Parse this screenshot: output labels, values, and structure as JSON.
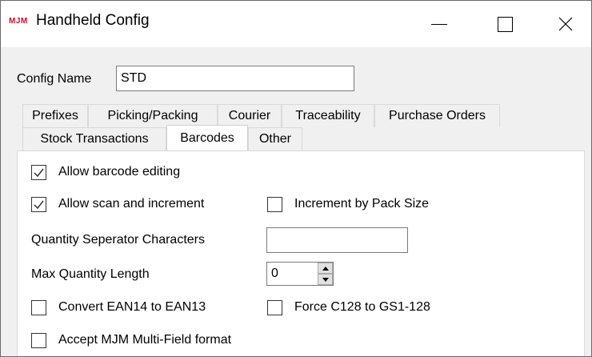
{
  "window": {
    "logo_text": "MJM",
    "title": "Handheld Config"
  },
  "config": {
    "name_label": "Config Name",
    "name_value": "STD"
  },
  "tabs": {
    "row1": [
      "Prefixes",
      "Picking/Packing",
      "Courier",
      "Traceability",
      "Purchase Orders"
    ],
    "row2": [
      "Stock Transactions",
      "Barcodes",
      "Other"
    ],
    "active": "Barcodes"
  },
  "barcodes": {
    "allow_editing": {
      "label": "Allow barcode editing",
      "checked": true
    },
    "allow_scan_increment": {
      "label": "Allow scan and increment",
      "checked": true
    },
    "increment_pack_size": {
      "label": "Increment by Pack Size",
      "checked": false
    },
    "qty_separator": {
      "label": "Quantity Seperator Characters",
      "value": ""
    },
    "max_qty_length": {
      "label": "Max Quantity Length",
      "value": "0"
    },
    "convert_ean": {
      "label": "Convert EAN14 to EAN13",
      "checked": false
    },
    "force_c128": {
      "label": "Force C128 to GS1-128",
      "checked": false
    },
    "accept_multifield": {
      "label": "Accept MJM Multi-Field format",
      "checked": false
    }
  }
}
